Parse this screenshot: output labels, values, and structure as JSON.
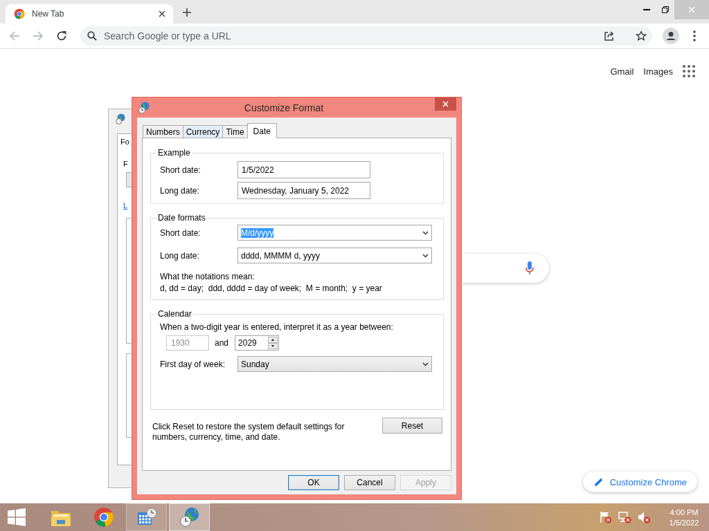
{
  "browser": {
    "tab": {
      "title": "New Tab"
    },
    "address_bar": {
      "placeholder": "Search Google or type a URL"
    },
    "links": [
      "Gmail",
      "Images"
    ],
    "customize_button": "Customize Chrome"
  },
  "background_dialog": {
    "tab": "Fo",
    "label": "F",
    "link": "L"
  },
  "dialog": {
    "title": "Customize Format",
    "tabs": [
      {
        "label": "Numbers",
        "selected": false
      },
      {
        "label": "Currency",
        "selected": false
      },
      {
        "label": "Time",
        "selected": false
      },
      {
        "label": "Date",
        "selected": true
      }
    ],
    "example": {
      "title": "Example",
      "fields": [
        {
          "label": "Short date:",
          "value": "1/5/2022"
        },
        {
          "label": "Long date:",
          "value": "Wednesday, January 5, 2022"
        }
      ]
    },
    "date_formats": {
      "title": "Date formats",
      "fields": [
        {
          "label": "Short date:",
          "value": "M/d/yyyy",
          "selected": true
        },
        {
          "label": "Long date:",
          "value": "dddd, MMMM d, yyyy",
          "selected": false
        }
      ],
      "notes": [
        "What the notations mean:",
        "d, dd = day;  ddd, dddd = day of week;  M = month;  y = year"
      ]
    },
    "calendar": {
      "title": "Calendar",
      "prompt": "When a two-digit year is entered, interpret it as a year between:",
      "year_from": {
        "value": "1930",
        "disabled": true
      },
      "and_label": "and",
      "year_to": {
        "value": "2029",
        "disabled": false
      },
      "first_day": {
        "label": "First day of week:",
        "value": "Sunday"
      }
    },
    "reset_text": "Click Reset to restore the system default settings for numbers, currency, time, and date.",
    "reset_button": "Reset",
    "buttons": [
      {
        "label": "OK",
        "default": true,
        "disabled": false
      },
      {
        "label": "Cancel",
        "default": false,
        "disabled": false
      },
      {
        "label": "Apply",
        "default": false,
        "disabled": true
      }
    ]
  },
  "taskbar": {
    "apps": [
      {
        "kind": "explorer",
        "open": false,
        "selected": false
      },
      {
        "kind": "chrome",
        "open": false,
        "selected": false
      },
      {
        "kind": "control-panel",
        "open": true,
        "selected": false
      },
      {
        "kind": "region",
        "open": true,
        "selected": true
      }
    ],
    "clock": {
      "time": "4:00 PM",
      "date": "1/5/2022"
    }
  }
}
